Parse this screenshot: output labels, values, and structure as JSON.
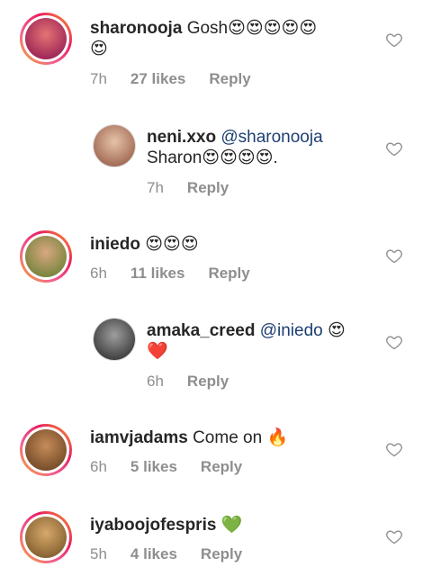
{
  "comments": [
    {
      "username": "sharonooja",
      "mention": "",
      "text": "Gosh",
      "emojis": "😍😍😍😍😍",
      "emojis2": "😍",
      "time": "7h",
      "likes": "27 likes",
      "reply": "Reply",
      "avatar_color": "#c2185b",
      "icon": "heart-outline-icon"
    },
    {
      "username": "neni.xxo",
      "mention": "@sharonooja",
      "text": "Sharon",
      "emojis": "😍😍😍😍.",
      "time": "7h",
      "reply": "Reply",
      "avatar_color": "#b0785f",
      "icon": "heart-outline-icon"
    },
    {
      "username": "iniedo",
      "mention": "",
      "text": "",
      "emojis": "😍😍😍",
      "time": "6h",
      "likes": "11 likes",
      "reply": "Reply",
      "avatar_color": "#7a9a3a",
      "icon": "heart-outline-icon"
    },
    {
      "username": "amaka_creed",
      "mention": "@iniedo",
      "text": "",
      "emojis": "😍",
      "emojis2": "❤️",
      "time": "6h",
      "reply": "Reply",
      "avatar_color": "#4a4a4a",
      "icon": "heart-outline-icon"
    },
    {
      "username": "iamvjadams",
      "mention": "",
      "text": "Come on",
      "emojis": "🔥",
      "time": "6h",
      "likes": "5 likes",
      "reply": "Reply",
      "avatar_color": "#a0522d",
      "icon": "heart-outline-icon"
    },
    {
      "username": "iyaboojofespris",
      "mention": "",
      "text": "",
      "emojis": "💚",
      "time": "5h",
      "likes": "4 likes",
      "reply": "Reply",
      "avatar_color": "#8b6b3d",
      "icon": "heart-outline-icon"
    }
  ]
}
